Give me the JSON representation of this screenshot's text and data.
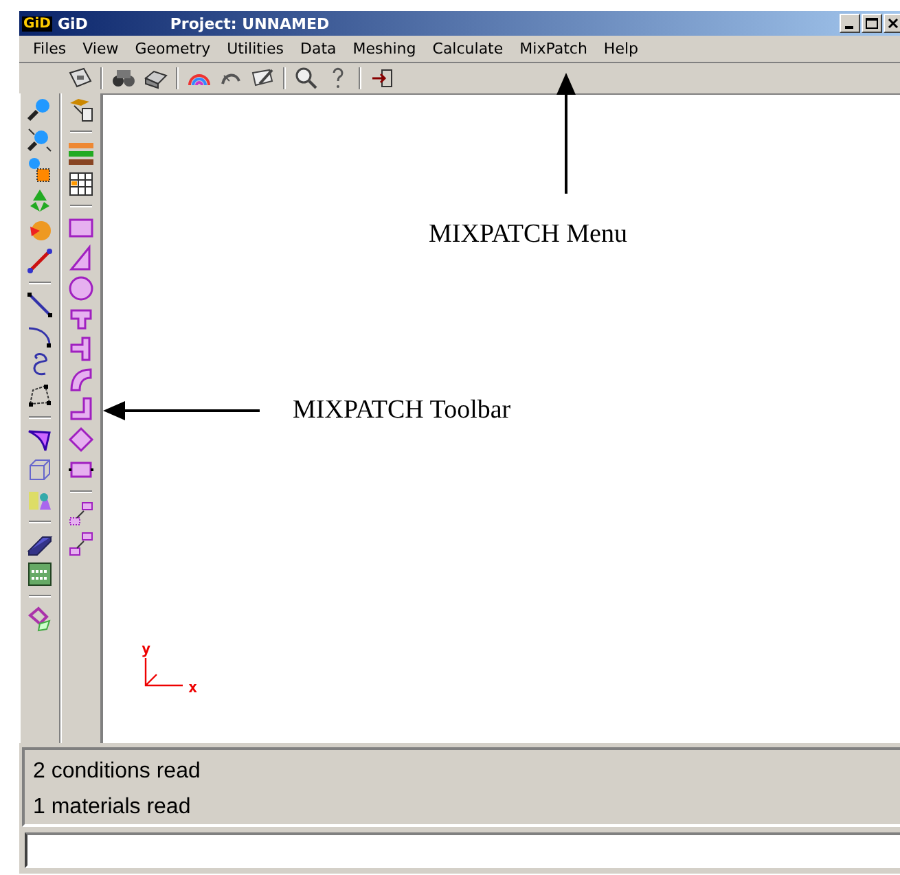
{
  "window": {
    "logo": "GiD",
    "app": "GiD",
    "title": "Project: UNNAMED"
  },
  "menu": [
    "Files",
    "View",
    "Geometry",
    "Utilities",
    "Data",
    "Meshing",
    "Calculate",
    "MixPatch",
    "Help"
  ],
  "canvas": {
    "axis_y": "y",
    "axis_x": "x"
  },
  "annotations": [
    {
      "kind": "up",
      "text": "MIXPATCH Menu"
    },
    {
      "kind": "left",
      "text": "MIXPATCH Toolbar"
    }
  ],
  "messages": [
    "2 conditions read",
    "1 materials read"
  ]
}
